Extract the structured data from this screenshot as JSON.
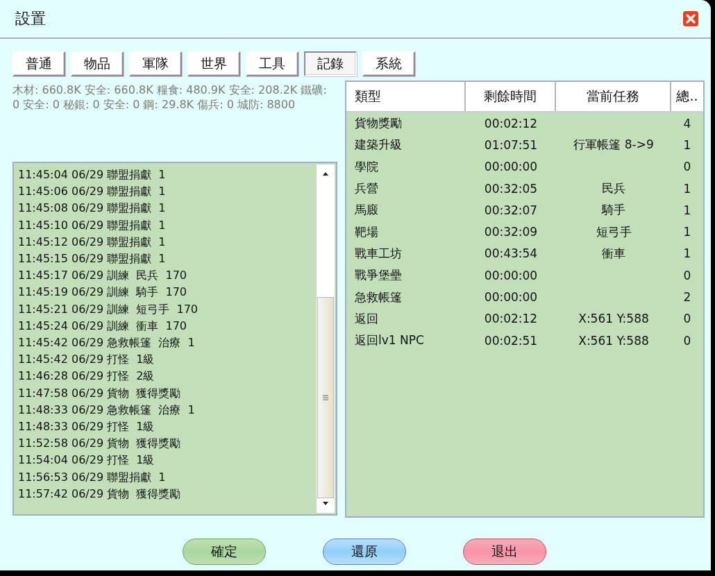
{
  "window": {
    "title": "設置"
  },
  "tabs": [
    {
      "label": "普通",
      "selected": false
    },
    {
      "label": "物品",
      "selected": false
    },
    {
      "label": "軍隊",
      "selected": false
    },
    {
      "label": "世界",
      "selected": false
    },
    {
      "label": "工具",
      "selected": false
    },
    {
      "label": "記錄",
      "selected": true
    },
    {
      "label": "系統",
      "selected": false
    }
  ],
  "resources": "木材: 660.8K 安全: 660.8K  糧食: 480.9K 安全: 208.2K  鐵礦: 0 安全: 0  秘銀: 0 安全: 0  鋼: 29.8K  傷兵: 0  城防: 8800",
  "log": [
    "11:45:04 06/29 聯盟捐獻  1",
    "11:45:06 06/29 聯盟捐獻  1",
    "11:45:08 06/29 聯盟捐獻  1",
    "11:45:10 06/29 聯盟捐獻  1",
    "11:45:12 06/29 聯盟捐獻  1",
    "11:45:15 06/29 聯盟捐獻  1",
    "11:45:17 06/29 訓練  民兵  170",
    "11:45:19 06/29 訓練  騎手  170",
    "11:45:21 06/29 訓練  短弓手  170",
    "11:45:24 06/29 訓練  衝車  170",
    "11:45:42 06/29 急救帳篷  治療  1",
    "11:45:42 06/29 打怪  1級",
    "11:46:28 06/29 打怪  2級",
    "11:47:58 06/29 貨物  獲得獎勵",
    "11:48:33 06/29 急救帳篷  治療  1",
    "11:48:33 06/29 打怪  1級",
    "11:52:58 06/29 貨物  獲得獎勵",
    "11:54:04 06/29 打怪  1級",
    "11:56:53 06/29 聯盟捐獻  1",
    "11:57:42 06/29 貨物  獲得獎勵"
  ],
  "table": {
    "columns": [
      "類型",
      "剩餘時間",
      "當前任務",
      "總.."
    ],
    "rows": [
      [
        "貨物獎勵",
        "00:02:12",
        "",
        "4"
      ],
      [
        "建築升級",
        "01:07:51",
        "行軍帳篷 8->9",
        "1"
      ],
      [
        "學院",
        "00:00:00",
        "",
        "0"
      ],
      [
        "兵營",
        "00:32:05",
        "民兵",
        "1"
      ],
      [
        "馬廄",
        "00:32:07",
        "騎手",
        "1"
      ],
      [
        "靶場",
        "00:32:09",
        "短弓手",
        "1"
      ],
      [
        "戰車工坊",
        "00:43:54",
        "衝車",
        "1"
      ],
      [
        "戰爭堡壘",
        "00:00:00",
        "",
        "0"
      ],
      [
        "急救帳篷",
        "00:00:00",
        "",
        "2"
      ],
      [
        "返回",
        "00:02:12",
        "X:561 Y:588",
        "0"
      ],
      [
        "返回lv1 NPC",
        "00:02:51",
        "X:561 Y:588",
        "0"
      ]
    ]
  },
  "buttons": [
    {
      "label": "確定",
      "kind": "green"
    },
    {
      "label": "還原",
      "kind": "blue"
    },
    {
      "label": "退出",
      "kind": "red"
    }
  ]
}
